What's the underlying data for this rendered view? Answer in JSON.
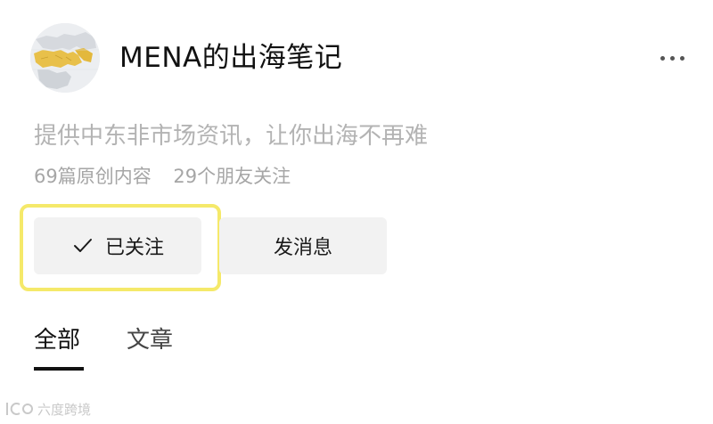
{
  "account": {
    "name": "MENA的出海笔记",
    "description": "提供中东非市场资讯，让你出海不再难",
    "stats": {
      "original_articles": "69篇原创内容",
      "friends_following": "29个朋友关注"
    }
  },
  "actions": {
    "followed_label": "已关注",
    "message_label": "发消息"
  },
  "tabs": [
    {
      "label": "全部",
      "active": true
    },
    {
      "label": "文章",
      "active": false
    }
  ],
  "icons": {
    "avatar": "mena-map-icon",
    "more": "more-dots-icon",
    "followed": "check-icon"
  },
  "colors": {
    "highlight_border": "#f5e96a",
    "button_bg": "#f2f2f2",
    "muted_text": "#b3b3b3",
    "map_highlight": "#e8c04a"
  },
  "watermark": {
    "text": "六度跨境"
  }
}
